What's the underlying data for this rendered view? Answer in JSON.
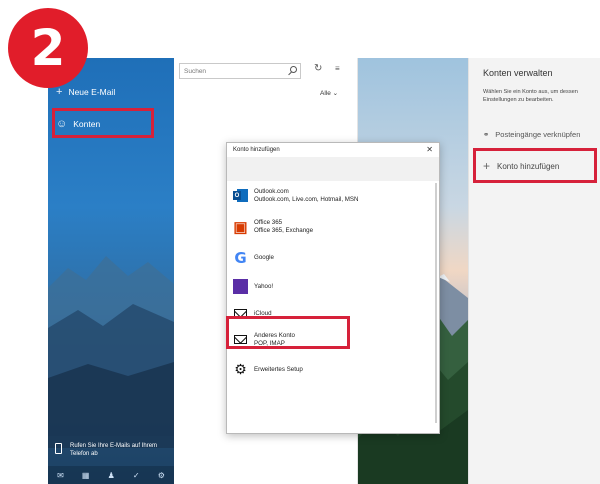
{
  "step_badge": "2",
  "nav": {
    "new_mail": "Neue E-Mail",
    "accounts": "Konten",
    "phone_prompt": "Rufen Sie Ihre E-Mails auf Ihrem Telefon ab"
  },
  "list": {
    "search_placeholder": "Suchen",
    "filter": "Alle"
  },
  "manage": {
    "title": "Konten verwalten",
    "description": "Wählen Sie ein Konto aus, um dessen Einstellungen zu bearbeiten.",
    "link_inboxes": "Posteingänge verknüpfen",
    "add_account": "Konto hinzufügen"
  },
  "dialog": {
    "title": "Konto hinzufügen",
    "accounts": [
      {
        "name": "Outlook.com",
        "detail": "Outlook.com, Live.com, Hotmail, MSN",
        "icon": "outlook-icon"
      },
      {
        "name": "Office 365",
        "detail": "Office 365, Exchange",
        "icon": "office-icon"
      },
      {
        "name": "Google",
        "detail": "",
        "icon": "google-icon"
      },
      {
        "name": "Yahoo!",
        "detail": "",
        "icon": "yahoo-icon"
      },
      {
        "name": "iCloud",
        "detail": "",
        "icon": "envelope-icon"
      },
      {
        "name": "Anderes Konto",
        "detail": "POP, IMAP",
        "icon": "envelope-icon"
      },
      {
        "name": "Erweitertes Setup",
        "detail": "",
        "icon": "gear-icon"
      }
    ]
  },
  "colors": {
    "highlight": "#d6213a",
    "badge": "#e11d2a",
    "nav_blue": "#2b7fc6"
  }
}
